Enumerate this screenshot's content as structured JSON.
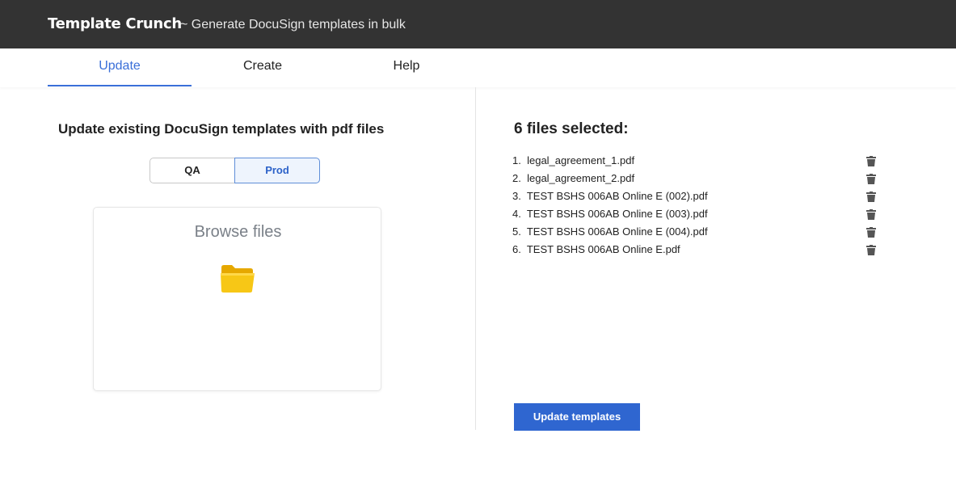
{
  "app": {
    "title": "Template Crunch",
    "subtitle": "~ Generate DocuSign templates in bulk"
  },
  "tabs": [
    {
      "label": "Update",
      "active": true
    },
    {
      "label": "Create",
      "active": false
    },
    {
      "label": "Help",
      "active": false
    }
  ],
  "left": {
    "heading": "Update existing DocuSign templates with pdf files",
    "environment": {
      "options": [
        "QA",
        "Prod"
      ],
      "selected": "Prod"
    },
    "dropzone": {
      "label": "Browse files",
      "icon": "folder-icon"
    }
  },
  "right": {
    "heading": "6 files selected:",
    "files": [
      {
        "num": "1.",
        "name": "legal_agreement_1.pdf"
      },
      {
        "num": "2.",
        "name": "legal_agreement_2.pdf"
      },
      {
        "num": "3.",
        "name": "TEST BSHS 006AB Online E (002).pdf"
      },
      {
        "num": "4.",
        "name": "TEST BSHS 006AB Online E (003).pdf"
      },
      {
        "num": "5.",
        "name": "TEST BSHS 006AB Online E (004).pdf"
      },
      {
        "num": "6.",
        "name": "TEST BSHS 006AB Online E.pdf"
      }
    ],
    "delete_icon": "trash-icon",
    "submit_label": "Update templates"
  },
  "colors": {
    "topbar": "#333333",
    "accent": "#3a6fd8",
    "button": "#2f66d0",
    "folder": "#f5c518"
  }
}
